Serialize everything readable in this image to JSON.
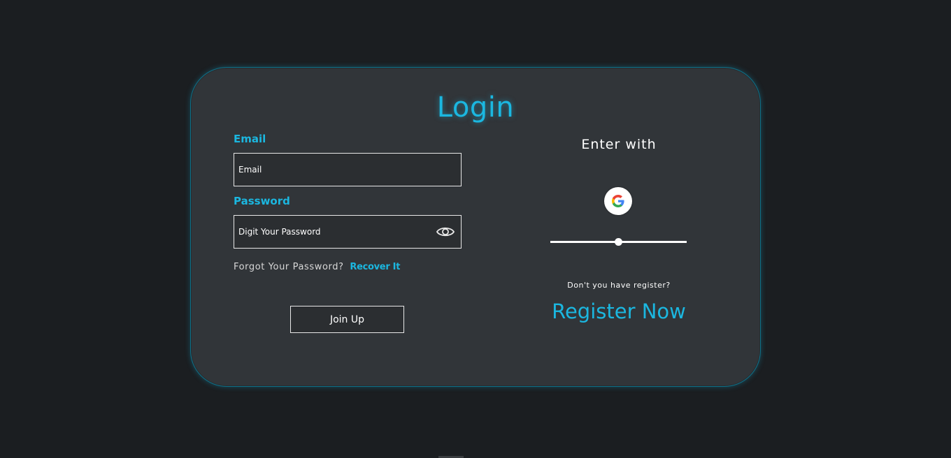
{
  "login": {
    "title": "Login",
    "email_label": "Email",
    "email_placeholder": "Email",
    "password_label": "Password",
    "password_placeholder": "Digit Your Password",
    "forgot_text": "Forgot Your Password?",
    "recover_link": "Recover It",
    "join_button": "Join Up"
  },
  "social": {
    "enter_with": "Enter with",
    "google_icon": "google-icon",
    "slider_value": 0.5,
    "no_register_text": "Don't you have register?",
    "register_link": "Register Now"
  },
  "colors": {
    "accent": "#1bb7e0",
    "background": "#1b1e21",
    "card": "#313539"
  }
}
